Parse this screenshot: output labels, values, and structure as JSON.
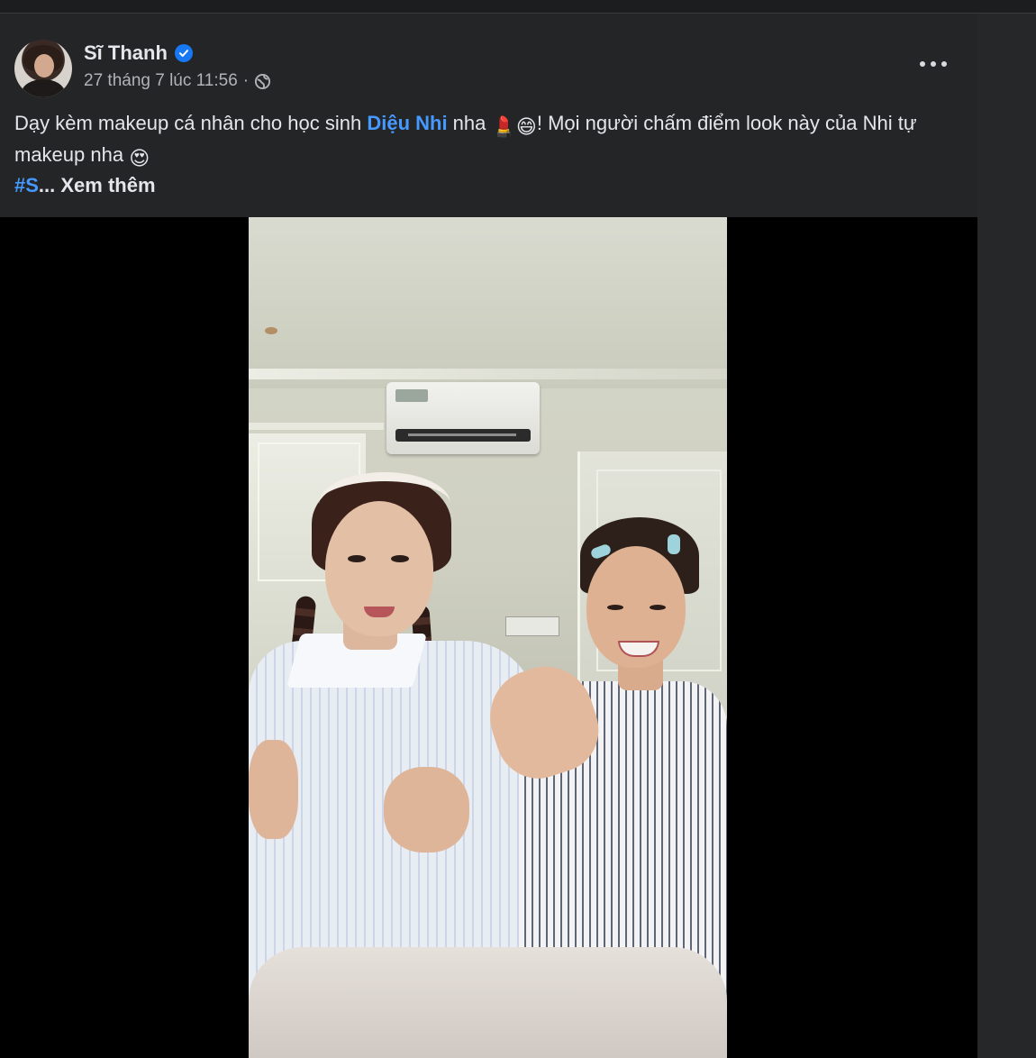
{
  "post": {
    "author": "Sĩ Thanh",
    "verified_icon": "verified-badge-icon",
    "timestamp": "27 tháng 7 lúc 11:56",
    "separator": "·",
    "privacy_icon": "globe-icon",
    "more_icon": "more-horizontal-icon",
    "text_part1": "Dạy kèm makeup cá nhân cho học sinh ",
    "mention": "Diệu Nhi",
    "text_part2": " nha ",
    "emoji1": "💄",
    "emoji2": "😄",
    "text_part3": "! Mọi người chấm điểm look này của Nhi tự makeup nha ",
    "emoji3": "😍",
    "hashtag": "#S",
    "ellipsis": "... ",
    "see_more": "Xem thêm"
  },
  "colors": {
    "background": "#242526",
    "text": "#e4e6eb",
    "secondary_text": "#b0b3b8",
    "link": "#4599ff",
    "verified": "#1877f2"
  },
  "video": {
    "kind": "portrait video of two women in striped shirts"
  }
}
